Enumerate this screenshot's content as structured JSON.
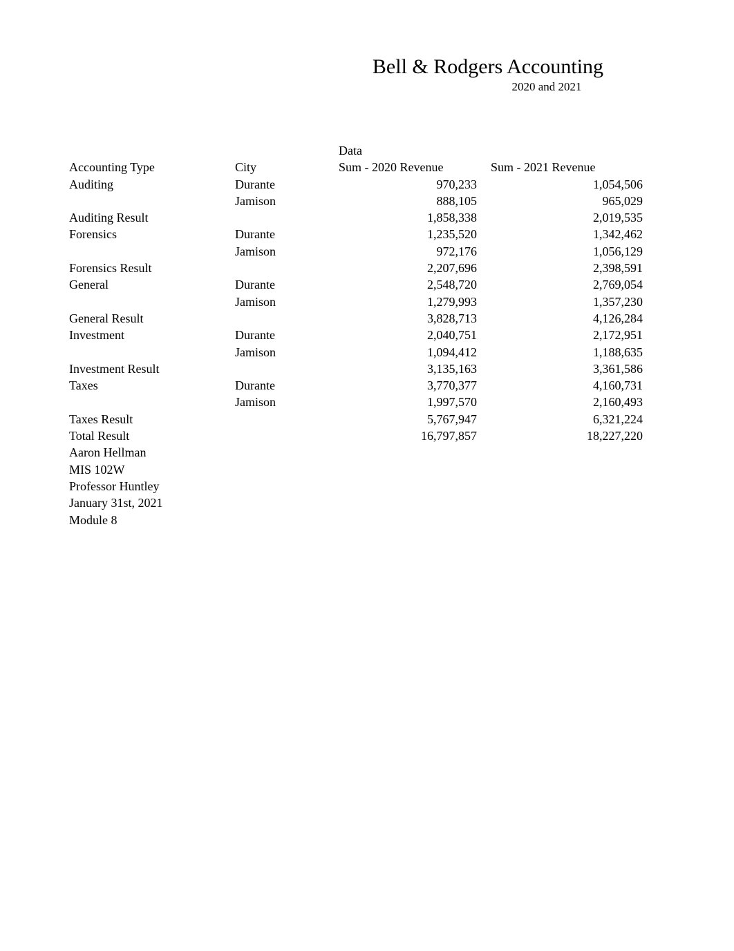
{
  "title": "Bell & Rodgers Accounting",
  "subtitle": "2020 and 2021",
  "headers": {
    "data_label": "Data",
    "accounting_type": "Accounting Type",
    "city": "City",
    "sum_2020": "Sum - 2020 Revenue",
    "sum_2021": "Sum - 2021 Revenue"
  },
  "groups": [
    {
      "type": "Auditing",
      "rows": [
        {
          "city": "Durante",
          "r2020": "970,233",
          "r2021": "1,054,506"
        },
        {
          "city": "Jamison",
          "r2020": "888,105",
          "r2021": "965,029"
        }
      ],
      "result_label": "Auditing Result",
      "result_2020": "1,858,338",
      "result_2021": "2,019,535"
    },
    {
      "type": "Forensics",
      "rows": [
        {
          "city": "Durante",
          "r2020": "1,235,520",
          "r2021": "1,342,462"
        },
        {
          "city": "Jamison",
          "r2020": "972,176",
          "r2021": "1,056,129"
        }
      ],
      "result_label": "Forensics Result",
      "result_2020": "2,207,696",
      "result_2021": "2,398,591"
    },
    {
      "type": "General",
      "rows": [
        {
          "city": "Durante",
          "r2020": "2,548,720",
          "r2021": "2,769,054"
        },
        {
          "city": "Jamison",
          "r2020": "1,279,993",
          "r2021": "1,357,230"
        }
      ],
      "result_label": "General Result",
      "result_2020": "3,828,713",
      "result_2021": "4,126,284"
    },
    {
      "type": "Investment",
      "rows": [
        {
          "city": "Durante",
          "r2020": "2,040,751",
          "r2021": "2,172,951"
        },
        {
          "city": "Jamison",
          "r2020": "1,094,412",
          "r2021": "1,188,635"
        }
      ],
      "result_label": "Investment Result",
      "result_2020": "3,135,163",
      "result_2021": "3,361,586"
    },
    {
      "type": "Taxes",
      "rows": [
        {
          "city": "Durante",
          "r2020": "3,770,377",
          "r2021": "4,160,731"
        },
        {
          "city": "Jamison",
          "r2020": "1,997,570",
          "r2021": "2,160,493"
        }
      ],
      "result_label": "Taxes Result",
      "result_2020": "5,767,947",
      "result_2021": "6,321,224"
    }
  ],
  "total": {
    "label": "Total Result",
    "r2020": "16,797,857",
    "r2021": "18,227,220"
  },
  "footer": {
    "line1": "Aaron Hellman",
    "line2": "MIS 102W",
    "line3": "Professor Huntley",
    "line4": "January 31st, 2021",
    "line5": "Module 8"
  }
}
